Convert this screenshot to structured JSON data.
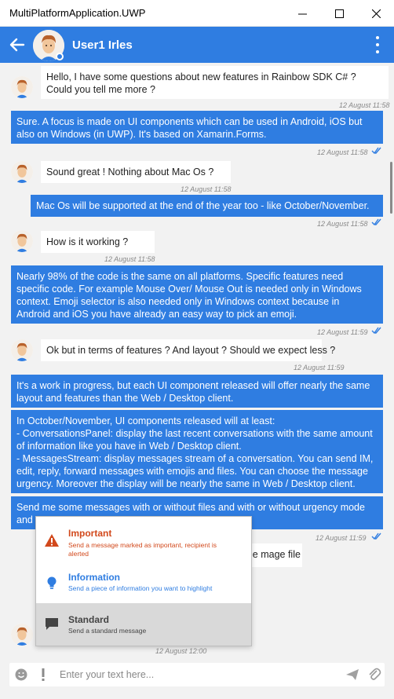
{
  "window": {
    "title": "MultiPlatformApplication.UWP"
  },
  "header": {
    "contact_name": "User1 Irles"
  },
  "messages": [
    {
      "lines": [
        "Hello, I have some questions about new features in Rainbow SDK C# ?",
        "Could you tell me more ?"
      ],
      "time": "12 August 11:58"
    },
    {
      "lines": [
        "Sure. A focus is made on UI components which can be used in Android, iOS but",
        "also on Windows (in UWP). It's based on Xamarin.Forms."
      ],
      "time": "12 August 11:58"
    },
    {
      "lines": [
        "Sound great ! Nothing about Mac Os ?"
      ],
      "time": "12 August 11:58"
    },
    {
      "lines": [
        "Mac Os will be supported at the end of the year too - like October/November."
      ],
      "time": "12 August 11:58"
    },
    {
      "lines": [
        "How is it working ?"
      ],
      "time": "12 August 11:58"
    },
    {
      "lines": [
        "Nearly 98% of the code is the same on all platforms. Specific features need",
        "specific code. For example Mouse Over/ Mouse Out is needed only in Windows",
        "context. Emoji selector is also needed only in Windows context because in",
        "Android and iOS you have already an easy way to pick an emoji."
      ],
      "time": "12 August 11:59"
    },
    {
      "lines": [
        "Ok but in terms of features ? And layout ? Should we expect less ?"
      ],
      "time": "12 August 11:59"
    },
    {
      "lines": [
        "It's a work in progress, but each UI component released will offer nearly the same",
        "layout and features than the Web / Desktop client."
      ]
    },
    {
      "lines": [
        "In October/November, UI components released will at least:",
        "- ConversationsPanel: display the last recent conversations with the same amount",
        "of information like you have in Web / Desktop client.",
        "- MessagesStream: display messages stream of a conversation. You can send IM,",
        "edit, reply, forward messages with emojis and files. You can choose the message",
        "urgency. Moreover the display will be nearly the same in Web / Desktop client."
      ]
    },
    {
      "lines": [
        "Send me some messages with or without files and with or without urgency mode",
        "and"
      ],
      "time": "12 August 11:59"
    },
    {
      "lines": [
        "le mage file"
      ],
      "time": "12 August 12:00"
    }
  ],
  "urgency_menu": {
    "items": [
      {
        "title": "Important",
        "desc": [
          "Send a message marked as important, recipient is",
          "alerted"
        ],
        "color": "#d2491c",
        "icon": "warning-icon"
      },
      {
        "title": "Information",
        "desc": [
          "Send a piece of information you want to highlight"
        ],
        "color": "#2f7de1",
        "icon": "lightbulb-icon"
      },
      {
        "title": "Standard",
        "desc": [
          "Send a standard message"
        ],
        "color": "#444444",
        "icon": "chat-bubble-icon"
      }
    ]
  },
  "composer": {
    "placeholder": "Enter your text here..."
  },
  "colors": {
    "accent": "#2f7de1",
    "important": "#d2491c",
    "background": "#f2f2f2"
  }
}
